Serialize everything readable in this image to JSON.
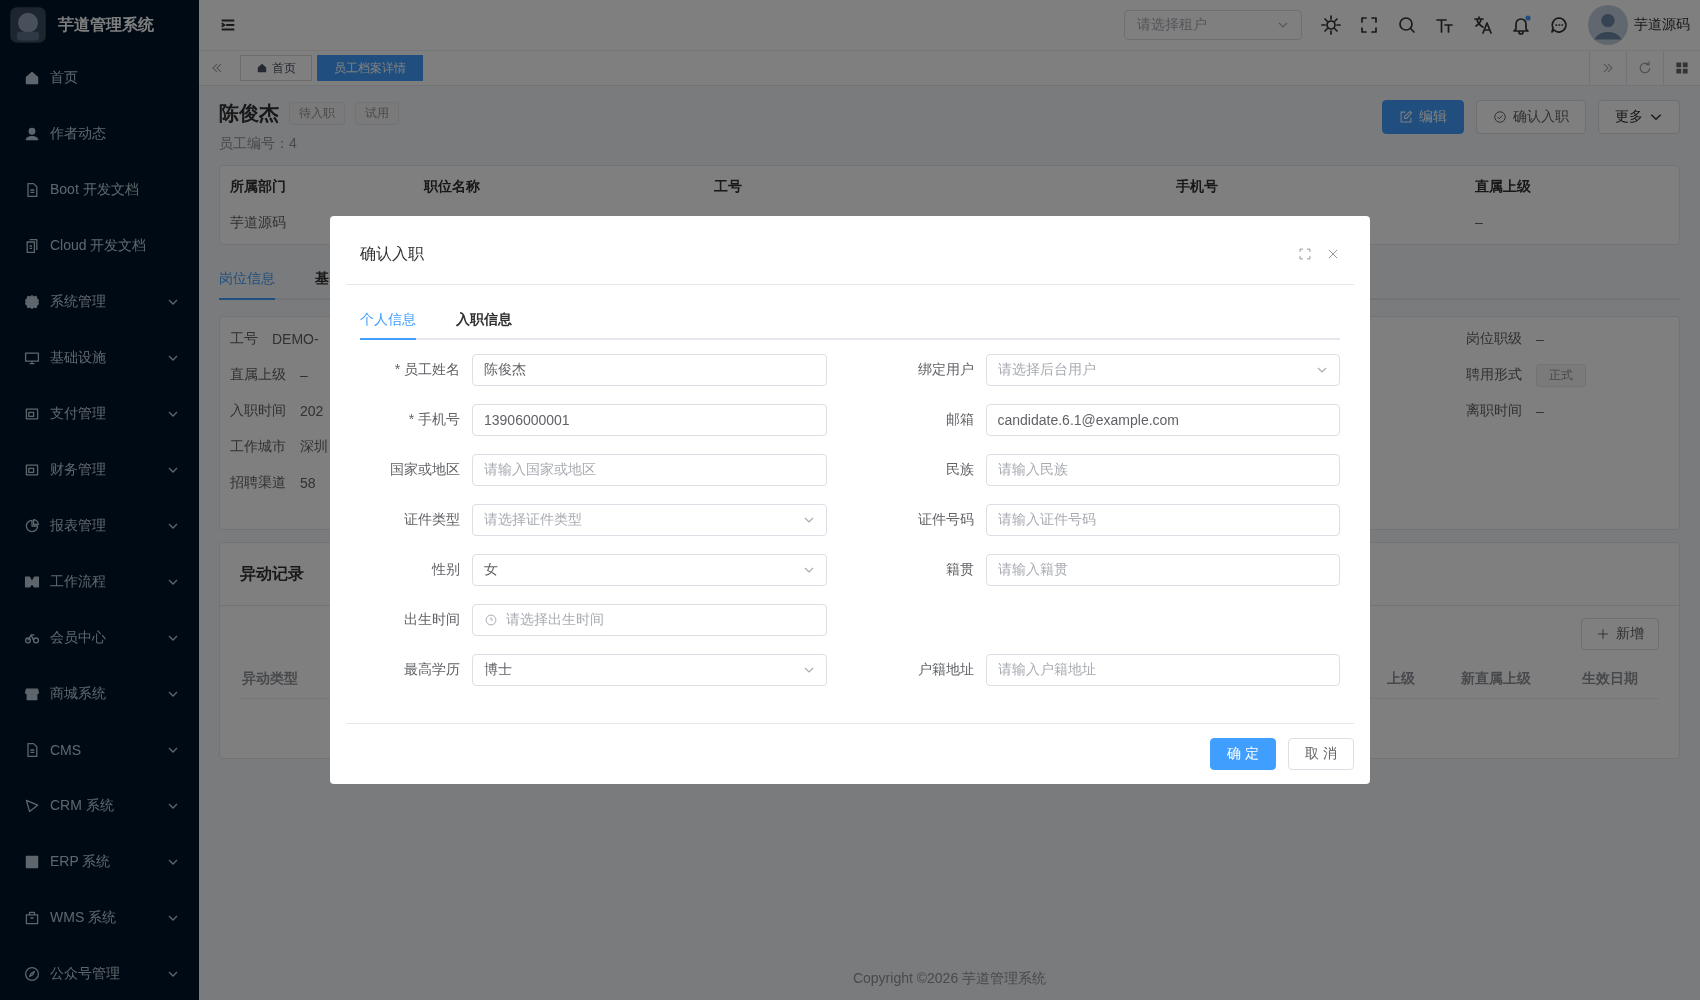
{
  "app": {
    "title": "芋道管理系统"
  },
  "sidebar": {
    "items": [
      {
        "label": "首页",
        "expandable": false
      },
      {
        "label": "作者动态",
        "expandable": false
      },
      {
        "label": "Boot 开发文档",
        "expandable": false
      },
      {
        "label": "Cloud 开发文档",
        "expandable": false
      },
      {
        "label": "系统管理",
        "expandable": true
      },
      {
        "label": "基础设施",
        "expandable": true
      },
      {
        "label": "支付管理",
        "expandable": true
      },
      {
        "label": "财务管理",
        "expandable": true
      },
      {
        "label": "报表管理",
        "expandable": true
      },
      {
        "label": "工作流程",
        "expandable": true
      },
      {
        "label": "会员中心",
        "expandable": true
      },
      {
        "label": "商城系统",
        "expandable": true
      },
      {
        "label": "CMS",
        "expandable": true
      },
      {
        "label": "CRM 系统",
        "expandable": true
      },
      {
        "label": "ERP 系统",
        "expandable": true
      },
      {
        "label": "WMS 系统",
        "expandable": true
      },
      {
        "label": "公众号管理",
        "expandable": true
      }
    ]
  },
  "header": {
    "tenant": {
      "placeholder": "请选择租户"
    },
    "notification_dot": true,
    "user": "芋道源码"
  },
  "page_tabs": [
    {
      "label": "首页",
      "selected": false
    },
    {
      "label": "员工档案详情",
      "selected": true
    }
  ],
  "profile": {
    "name": "陈俊杰",
    "tags": [
      "待入职",
      "试用"
    ],
    "employee_no": "员工编号：4",
    "actions": [
      {
        "label": "编辑",
        "kind": "primary"
      },
      {
        "label": "确认入职",
        "kind": "default"
      },
      {
        "label": "更多",
        "kind": "dropdown"
      }
    ]
  },
  "summary": {
    "columns": [
      {
        "label": "所属部门",
        "value": "芋道源码"
      },
      {
        "label": "职位名称"
      },
      {
        "label": "工号"
      },
      {
        "label": "手机号"
      },
      {
        "label": "直属上级",
        "value": "–"
      }
    ]
  },
  "detail_tabs": [
    {
      "label": "岗位信息",
      "selected": true
    },
    {
      "label": "基",
      "selected": false
    }
  ],
  "post_info": {
    "left": [
      {
        "label": "工号",
        "value": "DEMO-"
      },
      {
        "label": "直属上级",
        "value": "–"
      },
      {
        "label": "入职时间",
        "value": "202"
      },
      {
        "label": "工作城市",
        "value": "深圳"
      },
      {
        "label": "招聘渠道",
        "value": "58"
      }
    ],
    "right": [
      {
        "label": "岗位职级",
        "value": "–",
        "kind": "text"
      },
      {
        "label": "聘用形式",
        "value": "正式",
        "kind": "tag"
      },
      {
        "label": "离职时间",
        "value": "–",
        "kind": "text"
      }
    ]
  },
  "change_log": {
    "title": "异动记录",
    "add_button": "新增",
    "columns": [
      "异动类型",
      "上级",
      "新直属上级",
      "生效日期"
    ]
  },
  "footer": "Copyright ©2026 芋道管理系统",
  "dialog": {
    "title": "确认入职",
    "tabs": [
      {
        "label": "个人信息",
        "selected": true
      },
      {
        "label": "入职信息",
        "selected": false
      }
    ],
    "rows": [
      {
        "left": {
          "label": "* 员工姓名",
          "kind": "input",
          "value": "陈俊杰"
        },
        "right": {
          "label": "绑定用户",
          "kind": "select",
          "placeholder": "请选择后台用户"
        }
      },
      {
        "left": {
          "label": "* 手机号",
          "kind": "input",
          "value": "13906000001"
        },
        "right": {
          "label": "邮箱",
          "kind": "input",
          "value": "candidate.6.1@example.com"
        }
      },
      {
        "left": {
          "label": "国家或地区",
          "kind": "input",
          "placeholder": "请输入国家或地区"
        },
        "right": {
          "label": "民族",
          "kind": "input",
          "placeholder": "请输入民族"
        }
      },
      {
        "left": {
          "label": "证件类型",
          "kind": "select",
          "placeholder": "请选择证件类型"
        },
        "right": {
          "label": "证件号码",
          "kind": "input",
          "placeholder": "请输入证件号码"
        }
      },
      {
        "left": {
          "label": "性别",
          "kind": "select",
          "value": "女"
        },
        "right": {
          "label": "籍贯",
          "kind": "input",
          "placeholder": "请输入籍贯"
        }
      },
      {
        "left": {
          "label": "出生时间",
          "kind": "date",
          "placeholder": "请选择出生时间"
        }
      },
      {
        "left": {
          "label": "最高学历",
          "kind": "select",
          "value": "博士"
        },
        "right": {
          "label": "户籍地址",
          "kind": "input",
          "placeholder": "请输入户籍地址"
        }
      }
    ],
    "buttons": [
      {
        "label": "确 定",
        "kind": "primary"
      },
      {
        "label": "取 消",
        "kind": "default"
      }
    ]
  }
}
